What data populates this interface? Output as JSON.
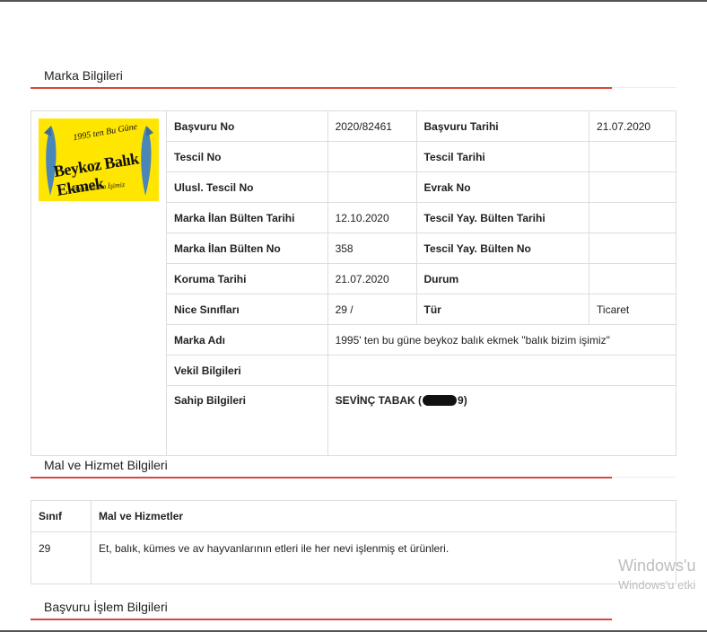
{
  "sections": {
    "marka": "Marka Bilgileri",
    "mal": "Mal ve Hizmet Bilgileri",
    "islem": "Başvuru İşlem Bilgileri"
  },
  "logo": {
    "line1": "1995 ten Bu Güne",
    "line2": "Beykoz Balık Ekmek",
    "line3": "Balık Bizim İşimiz",
    "color": "#ffe600"
  },
  "info": {
    "rows": [
      {
        "l1": "Başvuru No",
        "v1": "2020/82461",
        "l2": "Başvuru Tarihi",
        "v2": "21.07.2020"
      },
      {
        "l1": "Tescil No",
        "v1": "",
        "l2": "Tescil Tarihi",
        "v2": ""
      },
      {
        "l1": "Ulusl. Tescil No",
        "v1": "",
        "l2": "Evrak No",
        "v2": ""
      },
      {
        "l1": "Marka İlan Bülten Tarihi",
        "v1": "12.10.2020",
        "l2": "Tescil Yay. Bülten Tarihi",
        "v2": ""
      },
      {
        "l1": "Marka İlan Bülten No",
        "v1": "358",
        "l2": "Tescil Yay. Bülten No",
        "v2": ""
      },
      {
        "l1": "Koruma Tarihi",
        "v1": "21.07.2020",
        "l2": "Durum",
        "v2": ""
      },
      {
        "l1": "Nice Sınıfları",
        "v1": "29 /",
        "l2": "Tür",
        "v2": "Ticaret"
      }
    ],
    "marka_adi_label": "Marka Adı",
    "marka_adi_value": "1995' ten bu güne beykoz balık ekmek \"balık bizim işimiz\"",
    "vekil_label": "Vekil Bilgileri",
    "vekil_value": "",
    "sahip_label": "Sahip Bilgileri",
    "sahip_name": "SEVİNÇ TABAK (",
    "sahip_suffix": "9)"
  },
  "goods": {
    "headers": [
      "Sınıf",
      "Mal ve Hizmetler"
    ],
    "rows": [
      {
        "sinif": "29",
        "desc": "Et, balık, kümes ve av hayvanlarının etleri ile her nevi işlenmiş et ürünleri."
      }
    ]
  },
  "watermark": {
    "line1": "Windows'u",
    "line2": "Windows'u etki"
  },
  "colors": {
    "accent": "#d9473f"
  }
}
